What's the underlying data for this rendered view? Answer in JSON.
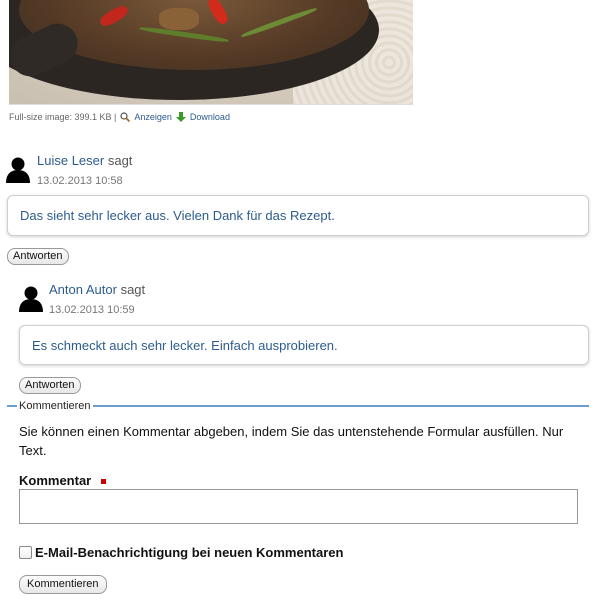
{
  "image_meta": {
    "size_text": "Full-size image: 399.1 KB |",
    "show_label": "Anzeigen",
    "download_label": "Download"
  },
  "comments": [
    {
      "author": "Luise Leser",
      "says": "sagt",
      "date": "13.02.2013 10:58",
      "text": "Das sieht sehr lecker aus. Vielen Dank für das Rezept.",
      "reply_label": "Antworten"
    },
    {
      "author": "Anton Autor",
      "says": "sagt",
      "date": "13.02.2013 10:59",
      "text": "Es schmeckt auch sehr lecker. Einfach ausprobieren.",
      "reply_label": "Antworten"
    }
  ],
  "form": {
    "legend": "Kommentieren",
    "intro": "Sie können einen Kommentar abgeben, indem Sie das untenstehende Formular ausfüllen. Nur Text.",
    "comment_label": "Kommentar",
    "comment_value": "",
    "notify_label": "E-Mail-Benachrichtigung bei neuen Kommentaren",
    "submit_label": "Kommentieren"
  },
  "colors": {
    "link": "#2c5c8f",
    "required": "#cc0000",
    "legend_line": "#6a9ccc"
  }
}
